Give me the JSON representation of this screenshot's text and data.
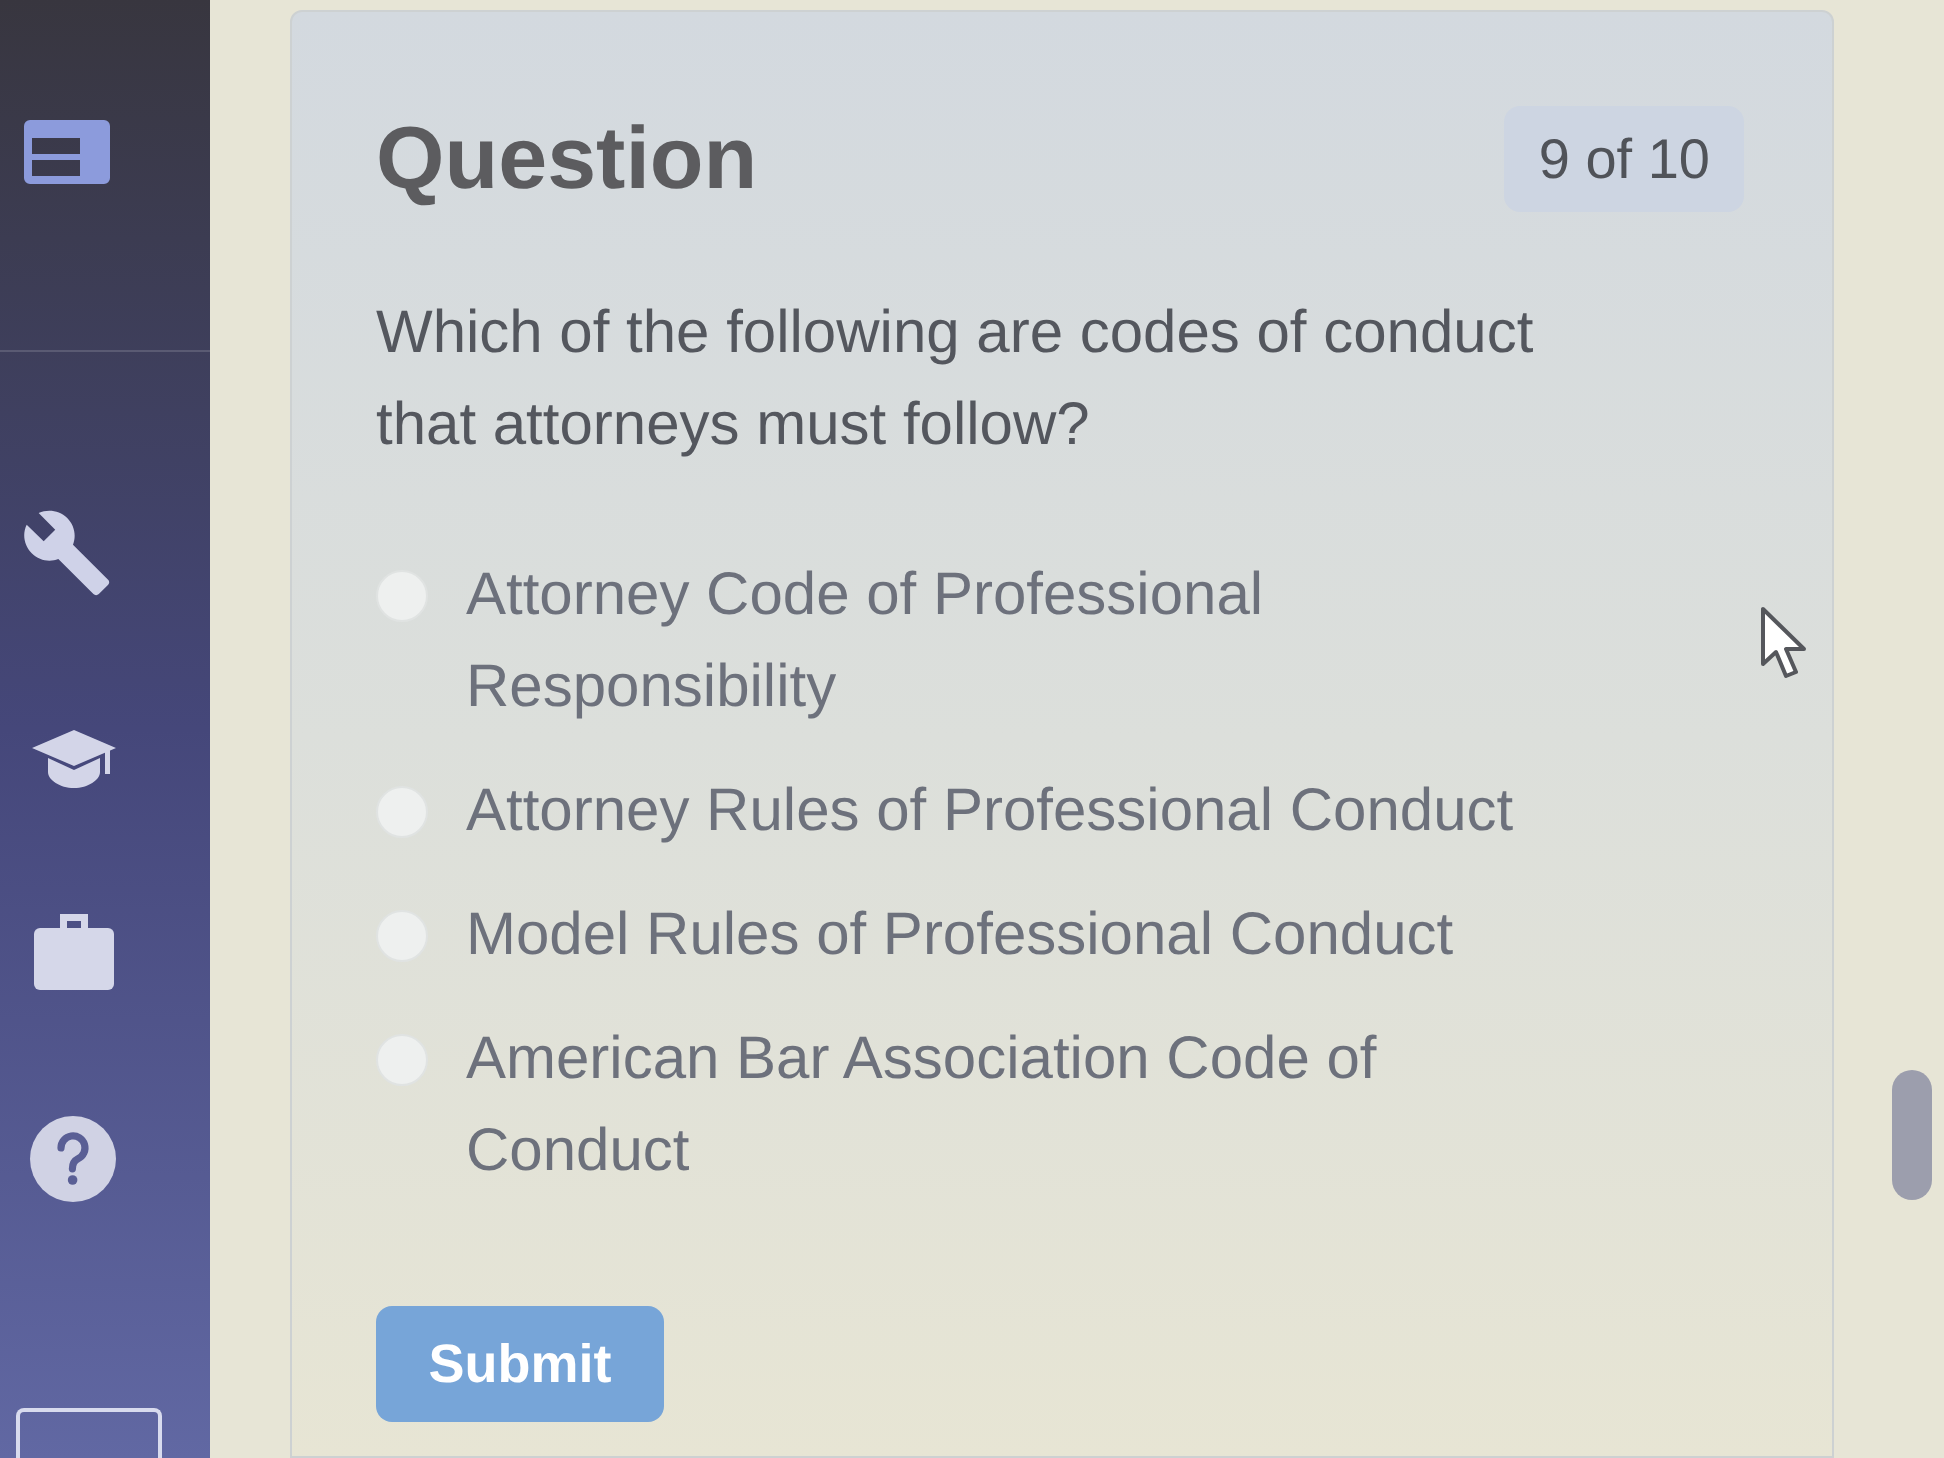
{
  "question": {
    "title": "Question",
    "counter": "9 of 10",
    "text": "Which of the following are codes of conduct that attorneys must follow?"
  },
  "options": [
    {
      "label": "Attorney Code of Professional Responsibility",
      "selected": false
    },
    {
      "label": "Attorney Rules of Professional Conduct",
      "selected": false
    },
    {
      "label": "Model Rules of Professional Conduct",
      "selected": false
    },
    {
      "label": "American Bar Association Code of Conduct",
      "selected": false
    }
  ],
  "submit_button": {
    "label": "Submit"
  }
}
